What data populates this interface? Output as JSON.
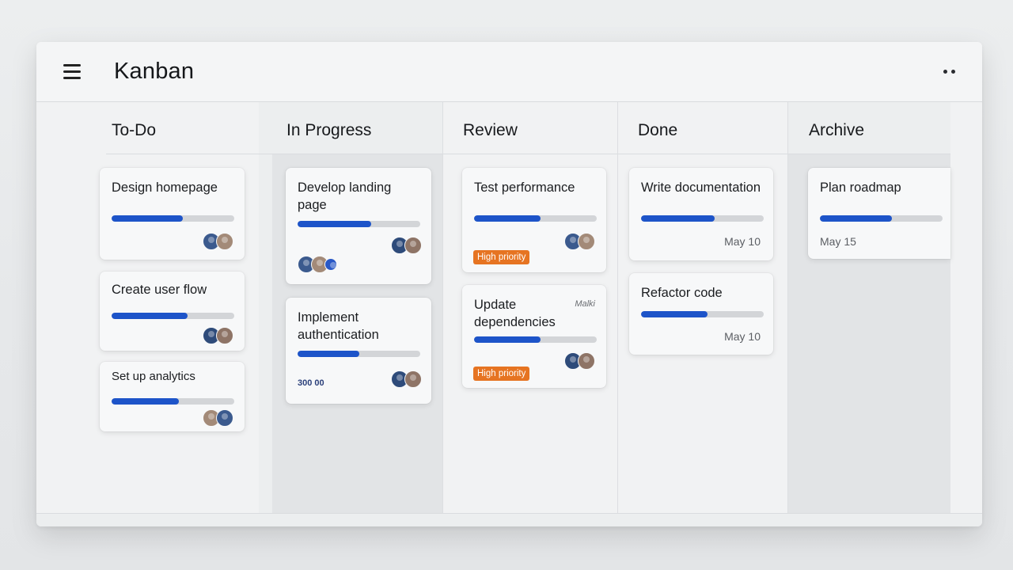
{
  "app": {
    "title": "Kanban"
  },
  "colors": {
    "accent": "#1d54c9",
    "priority": "#e67422"
  },
  "columns": [
    {
      "title": "To-Do",
      "cards": [
        {
          "title": "Design homepage",
          "progress": 0.58
        },
        {
          "title": "Create user flow",
          "progress": 0.62
        },
        {
          "title": "Set up analytics",
          "progress": 0.55
        }
      ]
    },
    {
      "title": "In Progress",
      "cards": [
        {
          "title": "Develop landing page",
          "progress": 0.6
        },
        {
          "title": "Implement authentication",
          "progress": 0.5,
          "meta": "300 00"
        }
      ]
    },
    {
      "title": "Review",
      "cards": [
        {
          "title": "Test performance",
          "progress": 0.54,
          "badge": "High priority"
        },
        {
          "title": "Update dependencies",
          "progress": 0.54,
          "badge": "High priority",
          "tag": "Malki"
        }
      ]
    },
    {
      "title": "Done",
      "cards": [
        {
          "title": "Write documentation",
          "progress": 0.6,
          "date": "May 10"
        },
        {
          "title": "Refactor code",
          "progress": 0.54,
          "date": "May 10"
        }
      ]
    },
    {
      "title": "Archive",
      "cards": [
        {
          "title": "Plan roadmap",
          "progress": 0.59,
          "date": "May 15"
        }
      ]
    }
  ]
}
